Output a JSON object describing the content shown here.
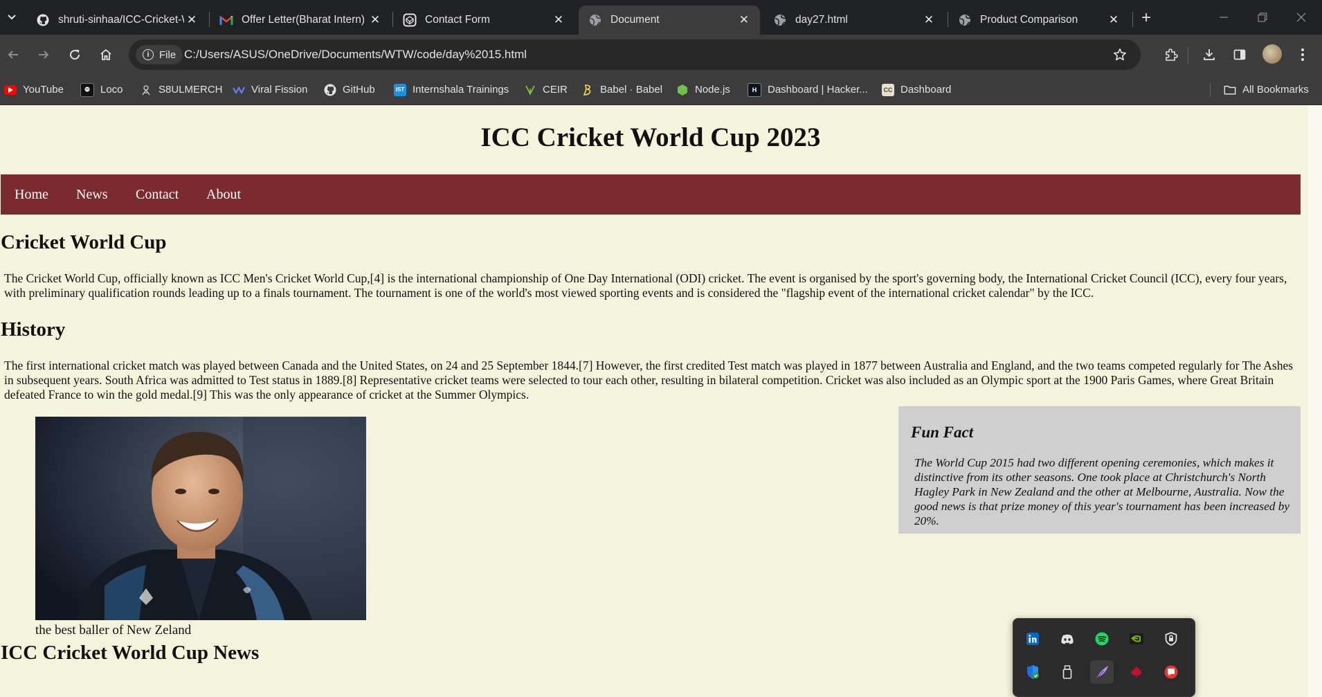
{
  "browser": {
    "tabs": [
      {
        "title": "shruti-sinhaa/ICC-Cricket-W",
        "icon": "github-icon",
        "active": false
      },
      {
        "title": "Offer Letter(Bharat Intern) |",
        "icon": "gmail-icon",
        "active": false
      },
      {
        "title": "Contact Form",
        "icon": "codepen-icon",
        "active": false
      },
      {
        "title": "Document",
        "icon": "globe-icon",
        "active": true
      },
      {
        "title": "day27.html",
        "icon": "globe-icon",
        "active": false
      },
      {
        "title": "Product Comparison",
        "icon": "globe-icon",
        "active": false
      }
    ],
    "address": {
      "chip_label": "File",
      "url": "C:/Users/ASUS/OneDrive/Documents/WTW/code/day%2015.html"
    },
    "bookmarks": [
      {
        "label": "YouTube",
        "icon": "youtube-icon"
      },
      {
        "label": "Loco",
        "icon": "loco-icon"
      },
      {
        "label": "S8ULMERCH",
        "icon": "s8ul-icon"
      },
      {
        "label": "Viral Fission",
        "icon": "viral-fission-icon"
      },
      {
        "label": "GitHub",
        "icon": "github-icon"
      },
      {
        "label": "Internshala Trainings",
        "icon": "internshala-icon"
      },
      {
        "label": "CEIR",
        "icon": "ceir-icon"
      },
      {
        "label": "Babel · Babel",
        "icon": "babel-icon"
      },
      {
        "label": "Node.js",
        "icon": "nodejs-icon"
      },
      {
        "label": "Dashboard | Hacker...",
        "icon": "hackerrank-icon"
      },
      {
        "label": "Dashboard",
        "icon": "codechef-icon"
      }
    ],
    "all_bookmarks_label": "All Bookmarks"
  },
  "page": {
    "title": "ICC Cricket World Cup 2023",
    "nav": [
      "Home",
      "News",
      "Contact",
      "About"
    ],
    "section1_heading": "Cricket World Cup",
    "section1_text": "The Cricket World Cup, officially known as ICC Men's Cricket World Cup,[4] is the international championship of One Day International (ODI) cricket. The event is organised by the sport's governing body, the International Cricket Council (ICC), every four years, with preliminary qualification rounds leading up to a finals tournament. The tournament is one of the world's most viewed sporting events and is considered the \"flagship event of the international cricket calendar\" by the ICC.",
    "section2_heading": "History",
    "section2_text": "The first international cricket match was played between Canada and the United States, on 24 and 25 September 1844.[7] However, the first credited Test match was played in 1877 between Australia and England, and the two teams competed regularly for The Ashes in subsequent years. South Africa was admitted to Test status in 1889.[8] Representative cricket teams were selected to tour each other, resulting in bilateral competition. Cricket was also included as an Olympic sport at the 1900 Paris Games, where Great Britain defeated France to win the gold medal.[9] This was the only appearance of cricket at the Summer Olympics.",
    "image_caption": "the best baller of New Zeland",
    "fun_fact_title": "Fun Fact",
    "fun_fact_text": "The World Cup 2015 had two different opening ceremonies, which makes it distinctive from its other seasons. One took place at Christchurch's North Hagley Park in New Zealand and the other at Melbourne, Australia. Now the good news is that prize money of this year's tournament has been increased by 20%.",
    "section3_heading": "ICC Cricket World Cup News"
  },
  "tray": {
    "icons": [
      "linkedin-icon",
      "discord-icon",
      "spotify-icon",
      "nvidia-icon",
      "security-shield-icon",
      "windows-security-icon",
      "usb-drive-icon",
      "feather-pen-icon",
      "maple-leaf-icon",
      "chat-app-icon"
    ]
  },
  "colors": {
    "page_background": "#f4f4dc",
    "navbar": "#7b2a2e",
    "fun_fact_box": "#cfcfcf",
    "chrome_dark": "#202124",
    "chrome_toolbar": "#3c3c3c"
  }
}
